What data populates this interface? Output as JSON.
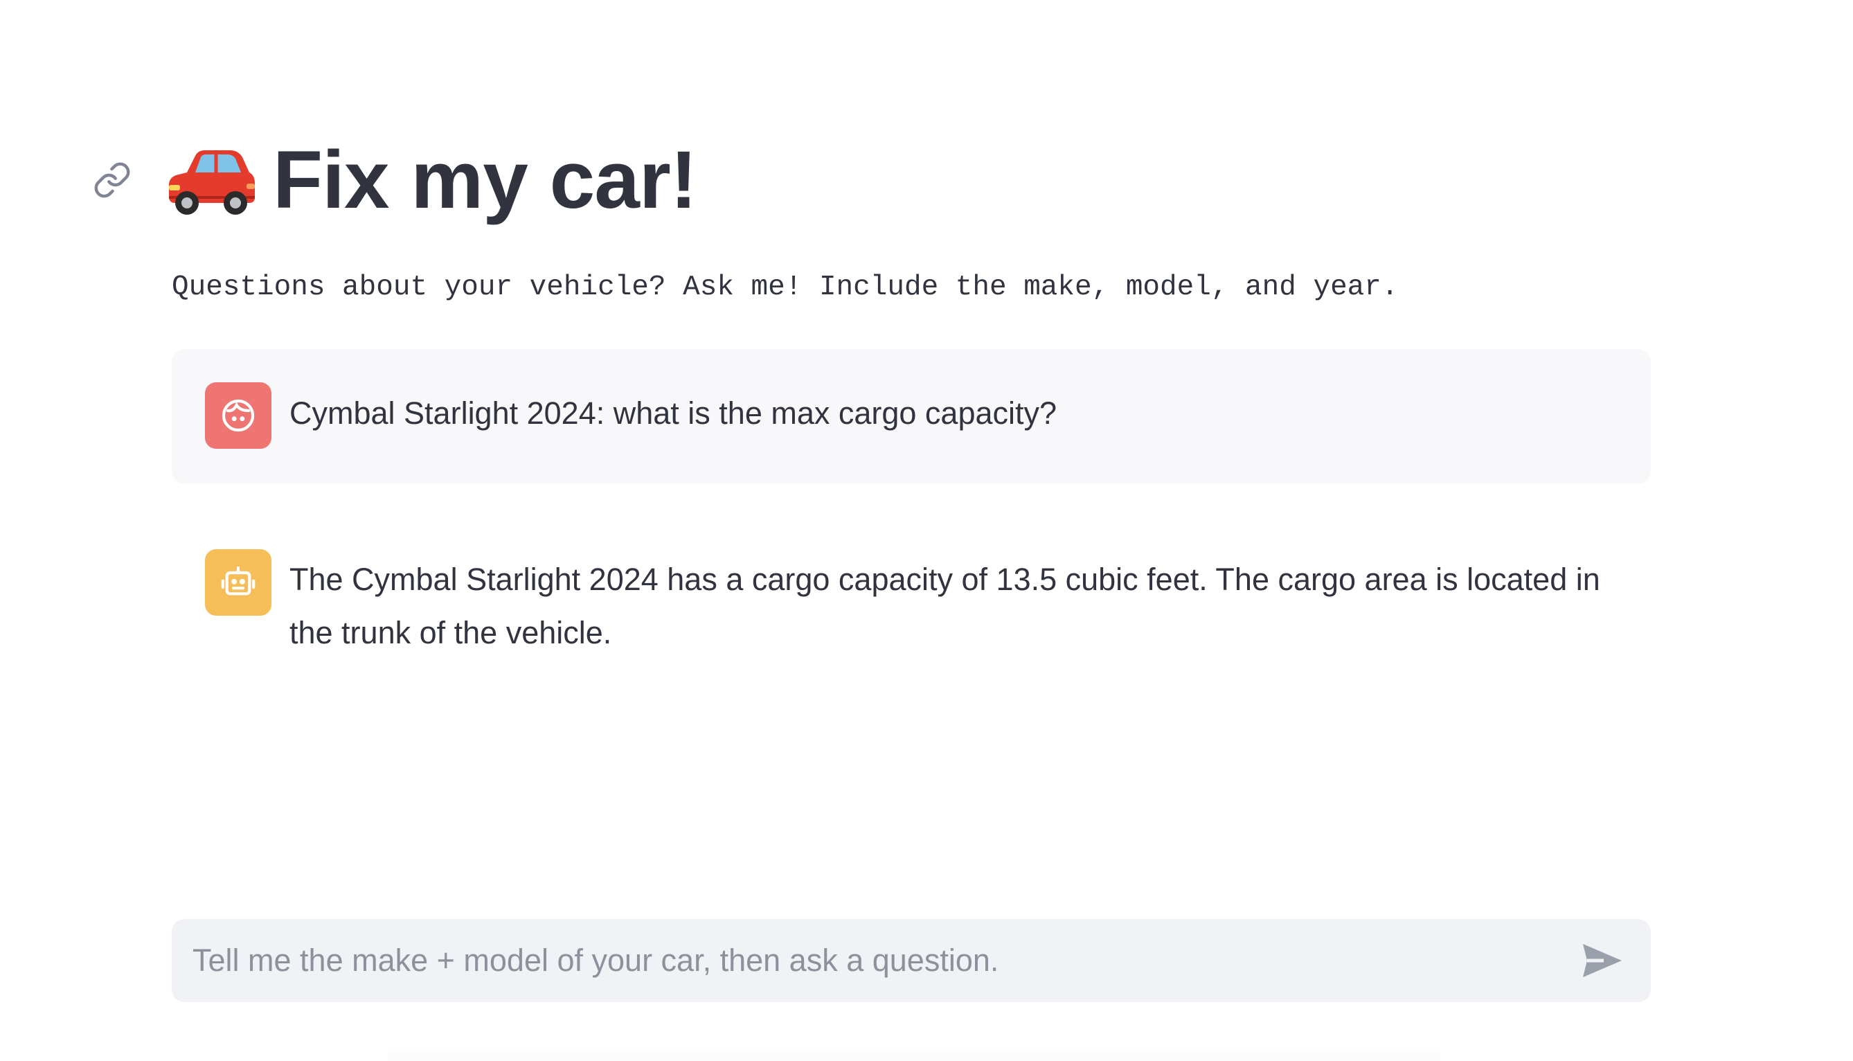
{
  "header": {
    "title": "Fix my car!",
    "title_emoji_icon": "red-car-icon",
    "anchor_icon": "link-icon"
  },
  "subtitle": "Questions about your vehicle? Ask me! Include the make, model, and year.",
  "messages": [
    {
      "role": "user",
      "avatar_icon": "user-face-icon",
      "avatar_color": "#ee7571",
      "text": "Cymbal Starlight 2024: what is the max cargo capacity?"
    },
    {
      "role": "assistant",
      "avatar_icon": "robot-icon",
      "avatar_color": "#f6be59",
      "text": "The Cymbal Starlight 2024 has a cargo capacity of 13.5 cubic feet. The cargo area is located in the trunk of the vehicle."
    }
  ],
  "chat_input": {
    "placeholder": "Tell me the make + model of your car, then ask a question.",
    "value": "",
    "send_icon": "send-icon"
  },
  "colors": {
    "text": "#31333f",
    "user_message_bg": "#f8f8fa",
    "input_bg": "#f0f2f6",
    "placeholder": "#8d919c"
  }
}
